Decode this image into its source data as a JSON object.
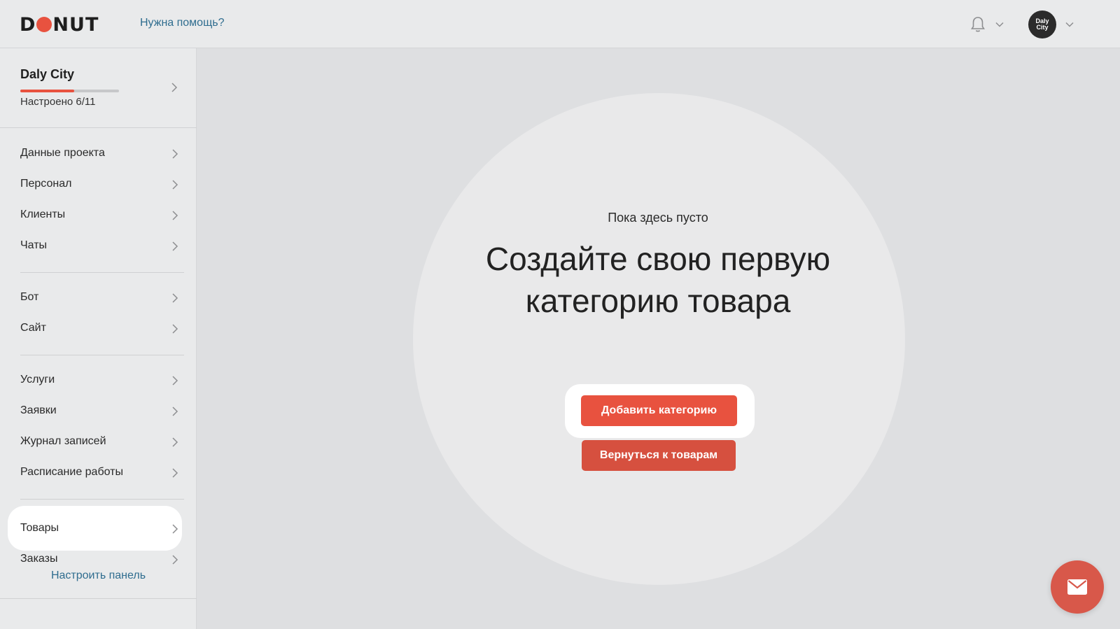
{
  "header": {
    "logo_text": "DONUT",
    "help_link": "Нужна помощь?",
    "avatar_text": "Daly City"
  },
  "sidebar": {
    "project": {
      "name": "Daly City",
      "status": "Настроено 6/11",
      "progress_fraction": 0.545
    },
    "groups": [
      [
        "Данные проекта",
        "Персонал",
        "Клиенты",
        "Чаты"
      ],
      [
        "Бот",
        "Сайт"
      ],
      [
        "Услуги",
        "Заявки",
        "Журнал записей",
        "Расписание работы"
      ],
      [
        "Товары",
        "Заказы"
      ]
    ],
    "items": [
      {
        "label": "Данные проекта"
      },
      {
        "label": "Персонал"
      },
      {
        "label": "Клиенты"
      },
      {
        "label": "Чаты"
      },
      {
        "label": "Бот"
      },
      {
        "label": "Сайт"
      },
      {
        "label": "Услуги"
      },
      {
        "label": "Заявки"
      },
      {
        "label": "Журнал записей"
      },
      {
        "label": "Расписание работы"
      },
      {
        "label": "Товары",
        "active": true
      },
      {
        "label": "Заказы"
      }
    ],
    "configure_link": "Настроить панель"
  },
  "main": {
    "empty_note": "Пока здесь пусто",
    "title": "Создайте свою первую категорию товара",
    "add_button": "Добавить категорию",
    "back_button": "Вернуться к товарам"
  },
  "colors": {
    "accent": "#e8523f",
    "link": "#2f6d8f",
    "background": "#dedfe1",
    "panel": "#e9eaeb"
  },
  "icons": {
    "notifications": "bell-icon",
    "dropdown": "chevron-down-icon",
    "row_arrow": "chevron-right-icon",
    "chat": "mail-icon"
  }
}
